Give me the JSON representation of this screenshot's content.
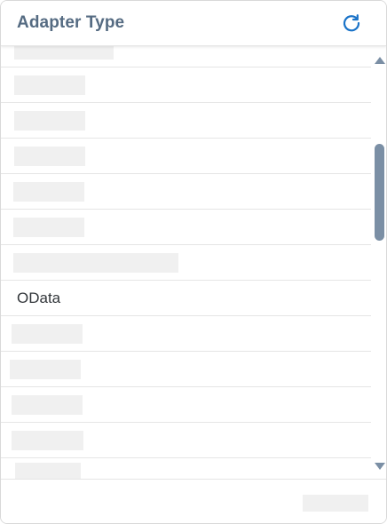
{
  "header": {
    "title": "Adapter Type",
    "refresh_icon": "refresh-icon",
    "accent_color": "#1a73c8"
  },
  "list": {
    "items": [
      {
        "label": "",
        "loading": true
      },
      {
        "label": "",
        "loading": true
      },
      {
        "label": "",
        "loading": true
      },
      {
        "label": "",
        "loading": true
      },
      {
        "label": "",
        "loading": true
      },
      {
        "label": "",
        "loading": true
      },
      {
        "label": "",
        "loading": true
      },
      {
        "label": "OData",
        "loading": false
      },
      {
        "label": "",
        "loading": true
      },
      {
        "label": "",
        "loading": true
      },
      {
        "label": "",
        "loading": true
      },
      {
        "label": "",
        "loading": true
      },
      {
        "label": "",
        "loading": true
      }
    ]
  },
  "scrollbar": {
    "up_icon": "triangle-up-icon",
    "down_icon": "triangle-down-icon",
    "thumb_color": "#7b8fa5"
  }
}
